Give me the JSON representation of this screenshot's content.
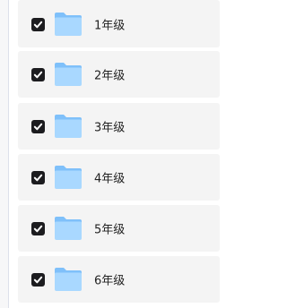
{
  "folders": [
    {
      "name": "1年级",
      "checked": true
    },
    {
      "name": "2年级",
      "checked": true
    },
    {
      "name": "3年级",
      "checked": true
    },
    {
      "name": "4年级",
      "checked": true
    },
    {
      "name": "5年级",
      "checked": true
    },
    {
      "name": "6年级",
      "checked": true
    }
  ],
  "colors": {
    "row_bg": "#f4f4f4",
    "checkbox": "#1c1c1f",
    "folder_light": "#a8d8ff",
    "folder_dark": "#6ab2f5"
  },
  "icons": {
    "checkbox": "checkmark-icon",
    "item": "folder-icon"
  }
}
